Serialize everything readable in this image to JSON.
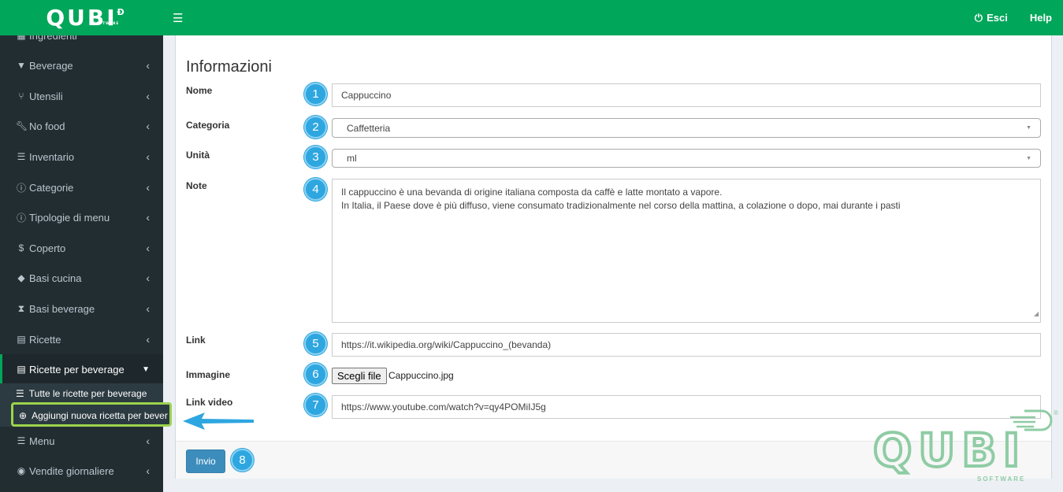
{
  "brand": {
    "name": "QUBI",
    "sub": "SOFTWARE"
  },
  "topbar": {
    "menu_icon": "hamburger-icon",
    "logout_label": "Esci",
    "help_label": "Help"
  },
  "sidebar": {
    "items": [
      {
        "label": "Ingredienti",
        "icon": "ingredients-icon"
      },
      {
        "label": "Beverage",
        "icon": "cocktail-icon"
      },
      {
        "label": "Utensili",
        "icon": "cutlery-icon"
      },
      {
        "label": "No food",
        "icon": "wrench-icon"
      },
      {
        "label": "Inventario",
        "icon": "table-icon"
      },
      {
        "label": "Categorie",
        "icon": "info-icon"
      },
      {
        "label": "Tipologie di menu",
        "icon": "info-icon"
      },
      {
        "label": "Coperto",
        "icon": "dollar-icon"
      },
      {
        "label": "Basi cucina",
        "icon": "cube-icon"
      },
      {
        "label": "Basi beverage",
        "icon": "hourglass-icon"
      },
      {
        "label": "Ricette",
        "icon": "file-icon"
      },
      {
        "label": "Ricette per beverage",
        "icon": "file-icon"
      },
      {
        "label": "Menu",
        "icon": "list-icon"
      },
      {
        "label": "Vendite giornaliere",
        "icon": "arrow-circle-icon"
      }
    ],
    "submenu": [
      {
        "label": "Tutte le ricette per beverage",
        "icon": "list-icon"
      },
      {
        "label": "Aggiungi nuova ricetta per bever",
        "icon": "plus-circle-icon"
      }
    ]
  },
  "form": {
    "title": "Informazioni",
    "fields": {
      "nome": {
        "label": "Nome",
        "value": "Cappuccino",
        "step": "1"
      },
      "categoria": {
        "label": "Categoria",
        "value": "Caffetteria",
        "step": "2"
      },
      "unita": {
        "label": "Unità",
        "value": "ml",
        "step": "3"
      },
      "note": {
        "label": "Note",
        "line1": "Il cappuccino è una bevanda di origine italiana composta da caffè e latte montato a vapore.",
        "line2": "In Italia, il Paese dove è più diffuso, viene consumato tradizionalmente nel corso della mattina, a colazione o dopo, mai durante i pasti",
        "step": "4"
      },
      "link": {
        "label": "Link",
        "value": "https://it.wikipedia.org/wiki/Cappuccino_(bevanda)",
        "step": "5"
      },
      "immagine": {
        "label": "Immagine",
        "button": "Scegli file",
        "file": "Cappuccino.jpg",
        "step": "6"
      },
      "link_video": {
        "label": "Link video",
        "value": "https://www.youtube.com/watch?v=qy4POMiIJ5g",
        "step": "7"
      }
    },
    "submit": {
      "label": "Invio",
      "step": "8"
    }
  },
  "colors": {
    "header": "#00a65a",
    "sidebar": "#222d32",
    "step_badge": "#2ea6e0",
    "highlight": "#9bd34c",
    "button": "#3c8dbc"
  }
}
